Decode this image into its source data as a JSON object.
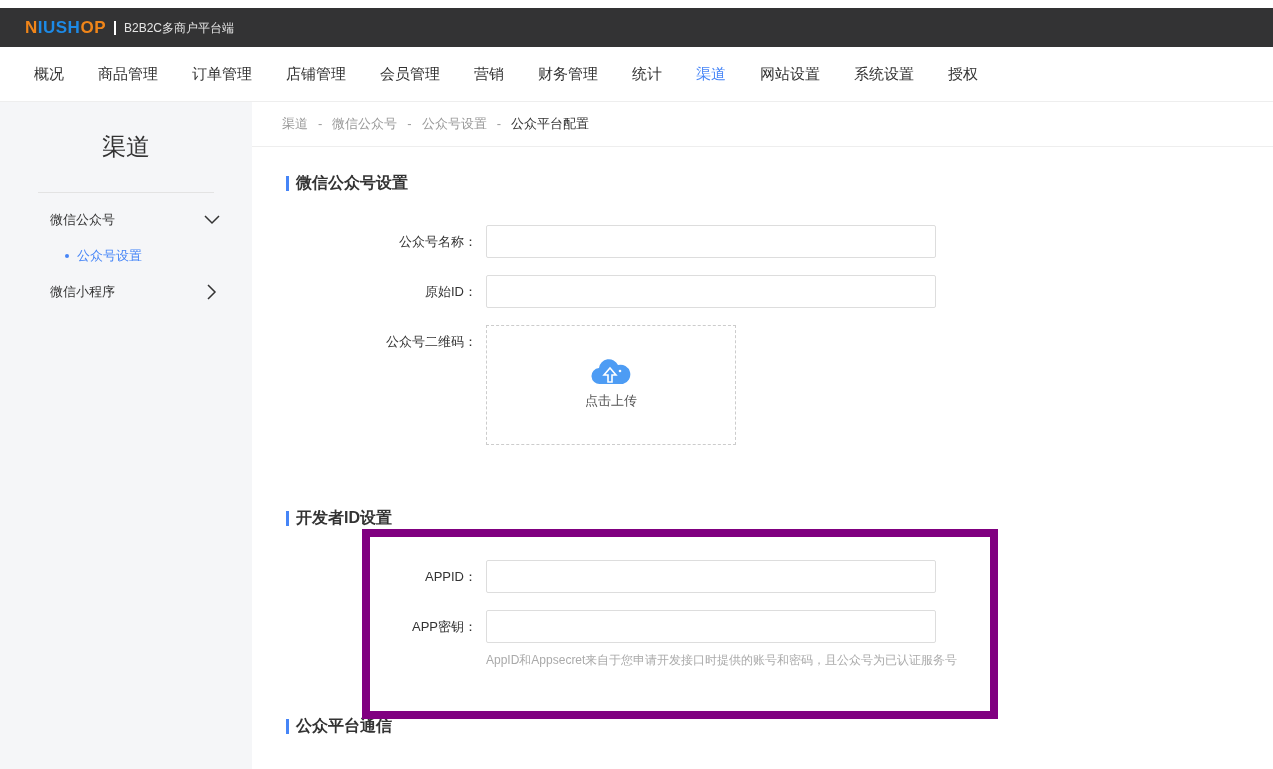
{
  "header": {
    "logo": [
      {
        "text": "N",
        "color": "#f08519"
      },
      {
        "text": "IUSH",
        "color": "#1d8ae6"
      },
      {
        "text": "OP",
        "color": "#f08519"
      }
    ],
    "subtitle": "B2B2C多商户平台端"
  },
  "nav": [
    {
      "label": "概况",
      "selected": false
    },
    {
      "label": "商品管理",
      "selected": false
    },
    {
      "label": "订单管理",
      "selected": false
    },
    {
      "label": "店铺管理",
      "selected": false
    },
    {
      "label": "会员管理",
      "selected": false
    },
    {
      "label": "营销",
      "selected": false
    },
    {
      "label": "财务管理",
      "selected": false
    },
    {
      "label": "统计",
      "selected": false
    },
    {
      "label": "渠道",
      "selected": true
    },
    {
      "label": "网站设置",
      "selected": false
    },
    {
      "label": "系统设置",
      "selected": false
    },
    {
      "label": "授权",
      "selected": false
    }
  ],
  "sidebar": {
    "title": "渠道",
    "items": [
      {
        "label": "微信公众号",
        "expanded": true,
        "children": [
          {
            "label": "公众号设置",
            "selected": true
          }
        ]
      },
      {
        "label": "微信小程序",
        "expanded": false
      }
    ]
  },
  "breadcrumb": [
    {
      "kind": "link",
      "text": "渠道"
    },
    {
      "kind": "separator",
      "text": "-"
    },
    {
      "kind": "link",
      "text": "微信公众号"
    },
    {
      "kind": "separator",
      "text": "-"
    },
    {
      "kind": "link",
      "text": "公众号设置"
    },
    {
      "kind": "separator",
      "text": "-"
    },
    {
      "kind": "current",
      "text": "公众平台配置"
    }
  ],
  "sections": [
    {
      "title": "微信公众号设置",
      "fields": [
        {
          "kind": "input",
          "label": "公众号名称："
        },
        {
          "kind": "input",
          "label": "原始ID："
        },
        {
          "kind": "upload",
          "label": "公众号二维码：",
          "button_text": "点击上传"
        }
      ]
    },
    {
      "title": "开发者ID设置",
      "fields": [
        {
          "kind": "input",
          "label": "APPID："
        },
        {
          "kind": "input",
          "label": "APP密钥：",
          "hint": "AppID和Appsecret来自于您申请开发接口时提供的账号和密码，且公众号为已认证服务号"
        }
      ],
      "highlighted": true
    },
    {
      "title": "公众平台通信"
    }
  ]
}
